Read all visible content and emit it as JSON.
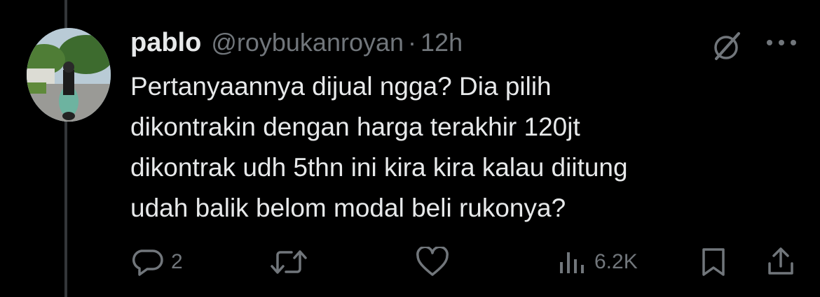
{
  "tweet": {
    "display_name": "pablo",
    "handle": "@roybukanroyan",
    "separator": "·",
    "time": "12h",
    "text_lines": [
      "Pertanyaannya dijual ngga? Dia pilih",
      "dikontrakin dengan harga terakhir 120jt",
      "dikontrak udh 5thn ini kira kira kalau diitung",
      "udah balik belom modal beli rukonya?"
    ]
  },
  "actions": {
    "reply_count": "2",
    "views_count": "6.2K"
  },
  "icons": {
    "grok": "grok-icon",
    "more": "more-icon",
    "reply": "reply-icon",
    "retweet": "retweet-icon",
    "like": "like-icon",
    "views": "views-icon",
    "bookmark": "bookmark-icon",
    "share": "share-icon"
  },
  "colors": {
    "background": "#000000",
    "text_primary": "#e7e9ea",
    "text_secondary": "#71767b",
    "thread_line": "#333639"
  }
}
